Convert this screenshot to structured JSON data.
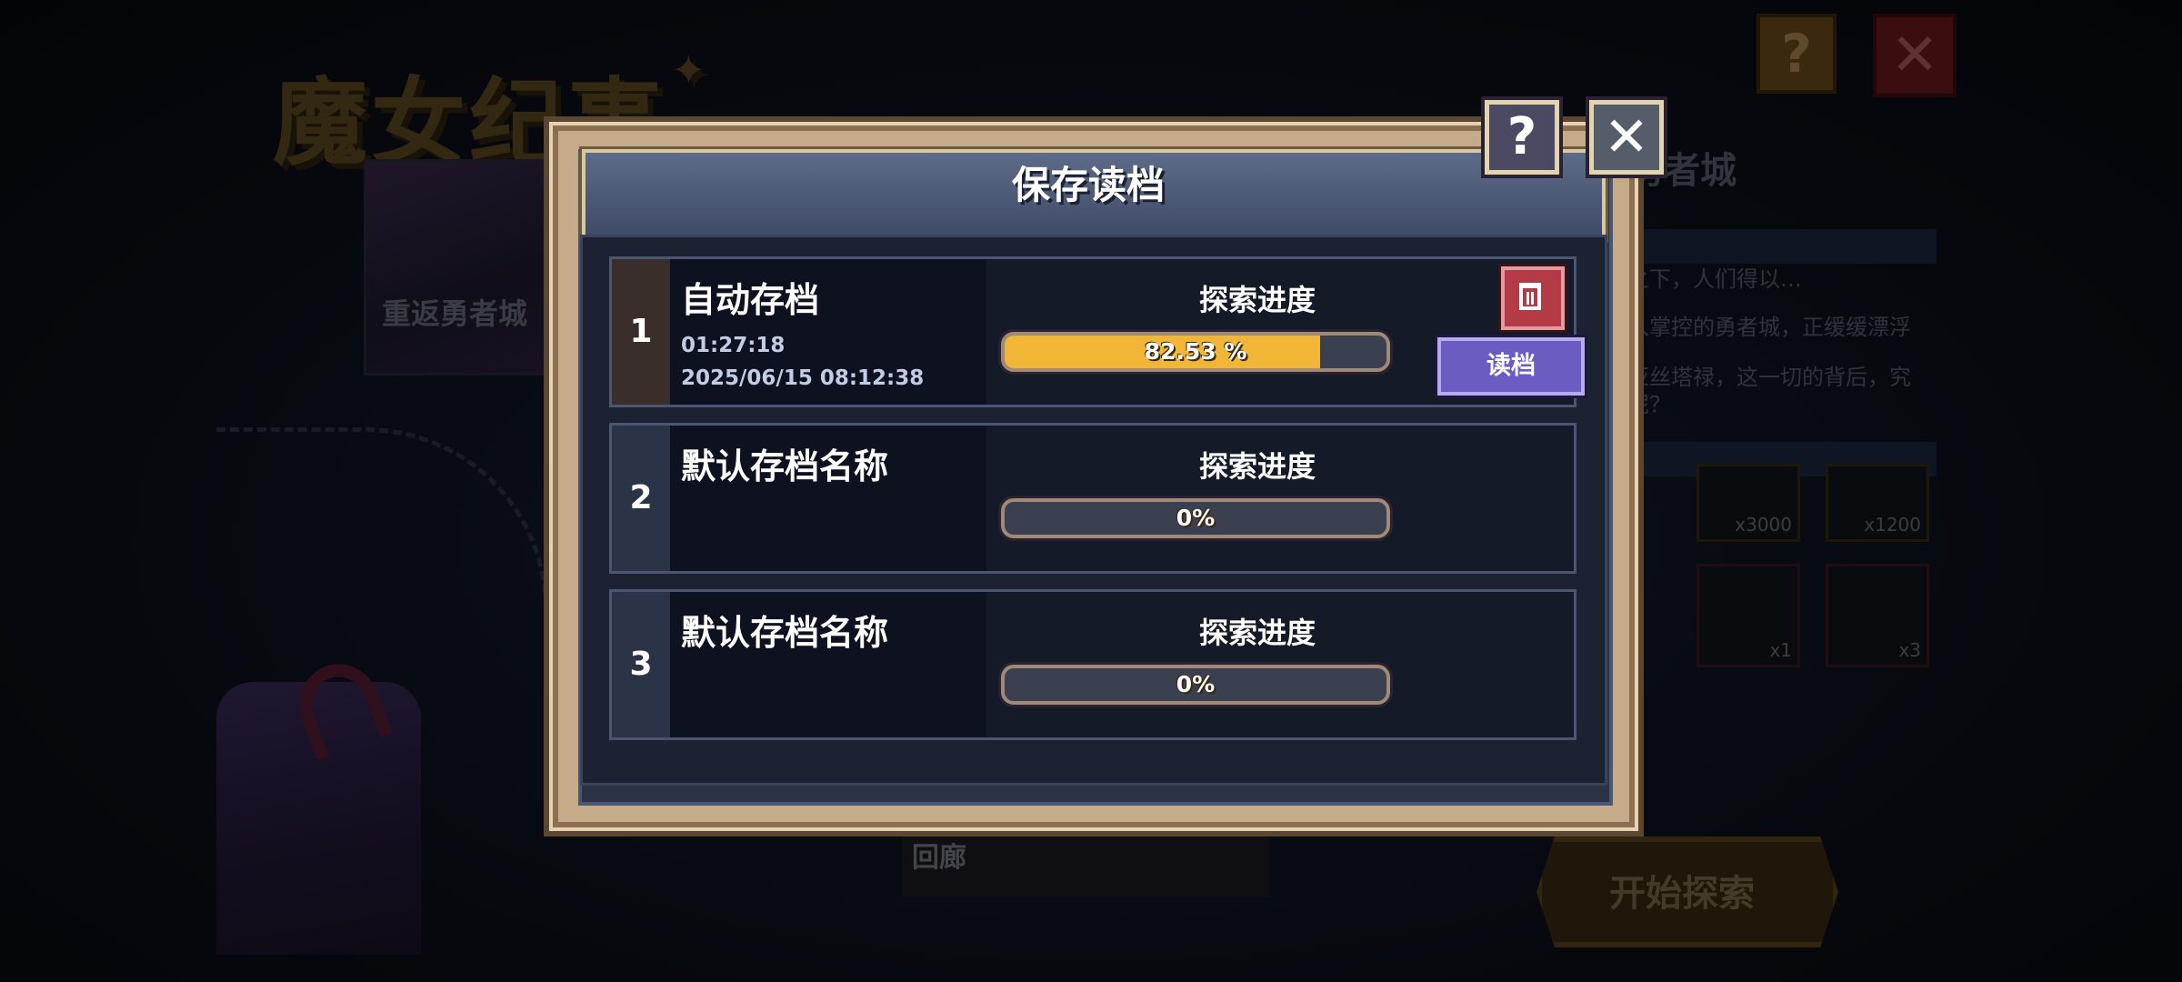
{
  "background": {
    "game_title": "魔女纪事",
    "card_label": "重返勇者城",
    "side_panel_title": "勇者城",
    "side_panel_lines": [
      "之下，人们得以…",
      "入掌控的勇者城，正缓缓漂浮",
      "亚丝塔禄，这一切的背后，究",
      "呢？"
    ],
    "item_counts": [
      "x3000",
      "x1200",
      "x1",
      "x3"
    ],
    "gallery_label": "回廊",
    "start_button": "开始探索",
    "help_glyph": "?",
    "close_glyph": "✕"
  },
  "modal": {
    "title": "保存读档",
    "help_glyph": "?",
    "close_glyph": "✕",
    "progress_label": "探索进度",
    "load_button": "读档",
    "slots": [
      {
        "index": "1",
        "name": "自动存档",
        "play_time": "01:27:18",
        "saved_at": "2025/06/15 08:12:38",
        "progress_text": "82.53 %",
        "progress": 82.53
      },
      {
        "index": "2",
        "name": "默认存档名称",
        "play_time": "",
        "saved_at": "",
        "progress_text": "0%",
        "progress": 0
      },
      {
        "index": "3",
        "name": "默认存档名称",
        "play_time": "",
        "saved_at": "",
        "progress_text": "0%",
        "progress": 0
      }
    ]
  },
  "colors": {
    "progress_fill": "#f2b637",
    "delete_button": "#b43a45",
    "load_button": "#6a5cc0"
  },
  "icons": {
    "delete": "trash-icon",
    "help": "question-icon",
    "close": "close-icon"
  }
}
